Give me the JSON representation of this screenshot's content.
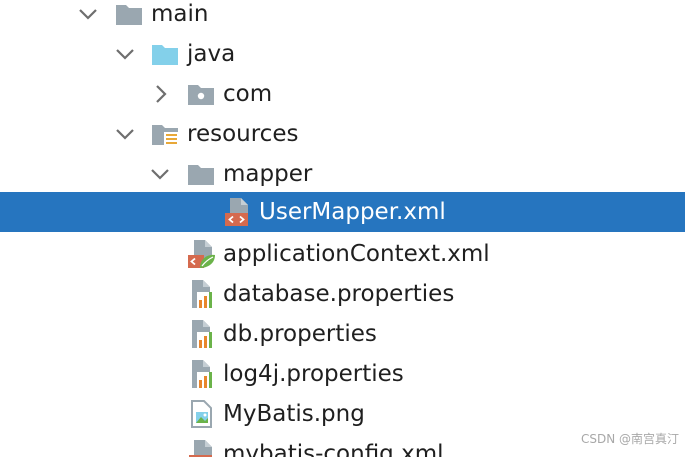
{
  "tree": {
    "items": [
      {
        "label": "main"
      },
      {
        "label": "java"
      },
      {
        "label": "com"
      },
      {
        "label": "resources"
      },
      {
        "label": "mapper"
      },
      {
        "label": "UserMapper.xml"
      },
      {
        "label": "applicationContext.xml"
      },
      {
        "label": "database.properties"
      },
      {
        "label": "db.properties"
      },
      {
        "label": "log4j.properties"
      },
      {
        "label": "MyBatis.png"
      },
      {
        "label": "mybatis-config.xml"
      }
    ],
    "selected_item": "UserMapper.xml"
  },
  "watermark": "CSDN @南宫真汀",
  "colors": {
    "selection": "#2675bf",
    "folder": "#9aa7b0",
    "source_folder": "#83d0ea",
    "xml_badge": "#d56a4e",
    "spring_leaf": "#6bb34a",
    "properties_bars": "#e8862d"
  }
}
